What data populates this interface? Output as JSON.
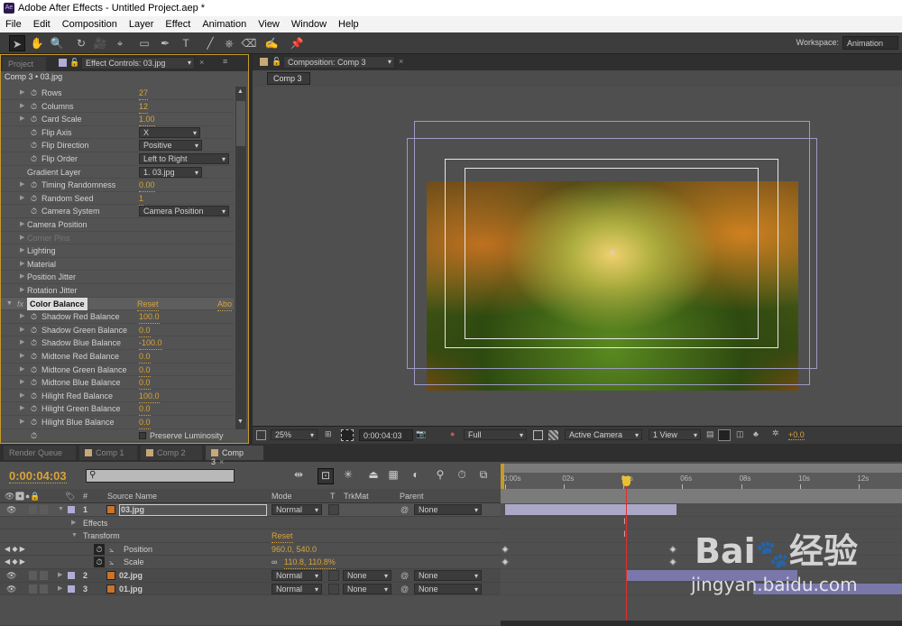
{
  "app": {
    "title": "Adobe After Effects - Untitled Project.aep *",
    "icon_text": "Ae"
  },
  "menu": [
    "File",
    "Edit",
    "Composition",
    "Layer",
    "Effect",
    "Animation",
    "View",
    "Window",
    "Help"
  ],
  "toolbar": {
    "tools": [
      "selection-tool",
      "hand-tool",
      "zoom-tool",
      "rotation-tool",
      "camera-tool",
      "pan-behind-tool",
      "rectangle-tool",
      "pen-tool",
      "type-tool",
      "brush-tool",
      "clone-stamp-tool",
      "eraser-tool",
      "roto-brush-tool",
      "puppet-pin-tool"
    ],
    "workspace_label": "Workspace:",
    "workspace_value": "Animation"
  },
  "effect_panel": {
    "tab_project": "Project",
    "tab_effect": "Effect Controls: 03.jpg",
    "header": "Comp 3 • 03.jpg",
    "rows": [
      {
        "label": "Rows",
        "value": "27",
        "kind": "num",
        "tri": true,
        "sw": true
      },
      {
        "label": "Columns",
        "value": "12",
        "kind": "num",
        "tri": true,
        "sw": true
      },
      {
        "label": "Card Scale",
        "value": "1.00",
        "kind": "num",
        "tri": true,
        "sw": true
      },
      {
        "label": "Flip Axis",
        "value": "X",
        "kind": "dd",
        "w": 68,
        "sw": true
      },
      {
        "label": "Flip Direction",
        "value": "Positive",
        "kind": "dd",
        "w": 70,
        "sw": true
      },
      {
        "label": "Flip Order",
        "value": "Left to Right",
        "kind": "dd",
        "w": 100,
        "sw": true
      },
      {
        "label": "Gradient Layer",
        "value": "1. 03.jpg",
        "kind": "dd",
        "w": 70,
        "sw": false
      },
      {
        "label": "Timing Randomness",
        "value": "0.00",
        "kind": "num",
        "tri": true,
        "sw": true
      },
      {
        "label": "Random Seed",
        "value": "1",
        "kind": "num",
        "tri": true,
        "sw": true
      },
      {
        "label": "Camera System",
        "value": "Camera Position",
        "kind": "dd",
        "w": 100,
        "sw": true
      },
      {
        "label": "Camera Position",
        "tri": true,
        "sw": false
      },
      {
        "label": "Corner Pins",
        "tri": true,
        "sw": false,
        "dim": true
      },
      {
        "label": "Lighting",
        "tri": true,
        "sw": false
      },
      {
        "label": "Material",
        "tri": true,
        "sw": false
      },
      {
        "label": "Position Jitter",
        "tri": true,
        "sw": false
      },
      {
        "label": "Rotation Jitter",
        "tri": true,
        "sw": false
      },
      {
        "label": "Color Balance",
        "kind": "fx",
        "reset": "Reset",
        "about": "Abo"
      },
      {
        "label": "Shadow Red Balance",
        "value": "100.0",
        "kind": "num",
        "tri": true,
        "sw": true
      },
      {
        "label": "Shadow Green Balance",
        "value": "0.0",
        "kind": "num",
        "tri": true,
        "sw": true
      },
      {
        "label": "Shadow Blue Balance",
        "value": "-100.0",
        "kind": "num",
        "tri": true,
        "sw": true
      },
      {
        "label": "Midtone Red Balance",
        "value": "0.0",
        "kind": "num",
        "tri": true,
        "sw": true
      },
      {
        "label": "Midtone Green Balance",
        "value": "0.0",
        "kind": "num",
        "tri": true,
        "sw": true
      },
      {
        "label": "Midtone Blue Balance",
        "value": "0.0",
        "kind": "num",
        "tri": true,
        "sw": true
      },
      {
        "label": "Hilight Red Balance",
        "value": "100.0",
        "kind": "num",
        "tri": true,
        "sw": true
      },
      {
        "label": "Hilight Green Balance",
        "value": "0.0",
        "kind": "num",
        "tri": true,
        "sw": true
      },
      {
        "label": "Hilight Blue Balance",
        "value": "0.0",
        "kind": "num",
        "tri": true,
        "sw": true
      },
      {
        "label": "",
        "value": "Preserve Luminosity",
        "kind": "check",
        "sw": true
      }
    ]
  },
  "composition": {
    "tab": "Composition: Comp 3",
    "comp_button": "Comp 3",
    "zoom": "25%",
    "timecode": "0:00:04:03",
    "resolution": "Full",
    "camera": "Active Camera",
    "views": "1 View",
    "exposure": "+0.0"
  },
  "timeline": {
    "tabs": [
      "Render Queue",
      "Comp 1",
      "Comp 2",
      "Comp 3"
    ],
    "timecode": "0:00:04:03",
    "search_placeholder": "",
    "ruler": [
      "0:00s",
      "02s",
      "04s",
      "06s",
      "08s",
      "10s",
      "12s"
    ],
    "current_time_s": 4.1,
    "columns": {
      "num": "#",
      "source": "Source Name",
      "mode": "Mode",
      "t": "T",
      "trkmat": "TrkMat",
      "parent": "Parent"
    },
    "layers": [
      {
        "num": "1",
        "name": "03.jpg",
        "mode": "Normal",
        "trkmat": "",
        "parent": "None",
        "in": 0,
        "out": 5.8
      },
      {
        "num": "2",
        "name": "02.jpg",
        "mode": "Normal",
        "trkmat": "None",
        "parent": "None",
        "in": 4.1,
        "out": 9.9
      },
      {
        "num": "3",
        "name": "01.jpg",
        "mode": "Normal",
        "trkmat": "None",
        "parent": "None",
        "in": 8.4,
        "out": 14
      }
    ],
    "effects_label": "Effects",
    "transform_label": "Transform",
    "transform_reset": "Reset",
    "position_label": "Position",
    "position_value": "960.0, 540.0",
    "scale_label": "Scale",
    "scale_value": "110.8, 110.8%",
    "keyframes_s": [
      0,
      5.7
    ]
  },
  "watermark": {
    "logo": "Bai du 经验",
    "url": "jingyan.baidu.com"
  }
}
